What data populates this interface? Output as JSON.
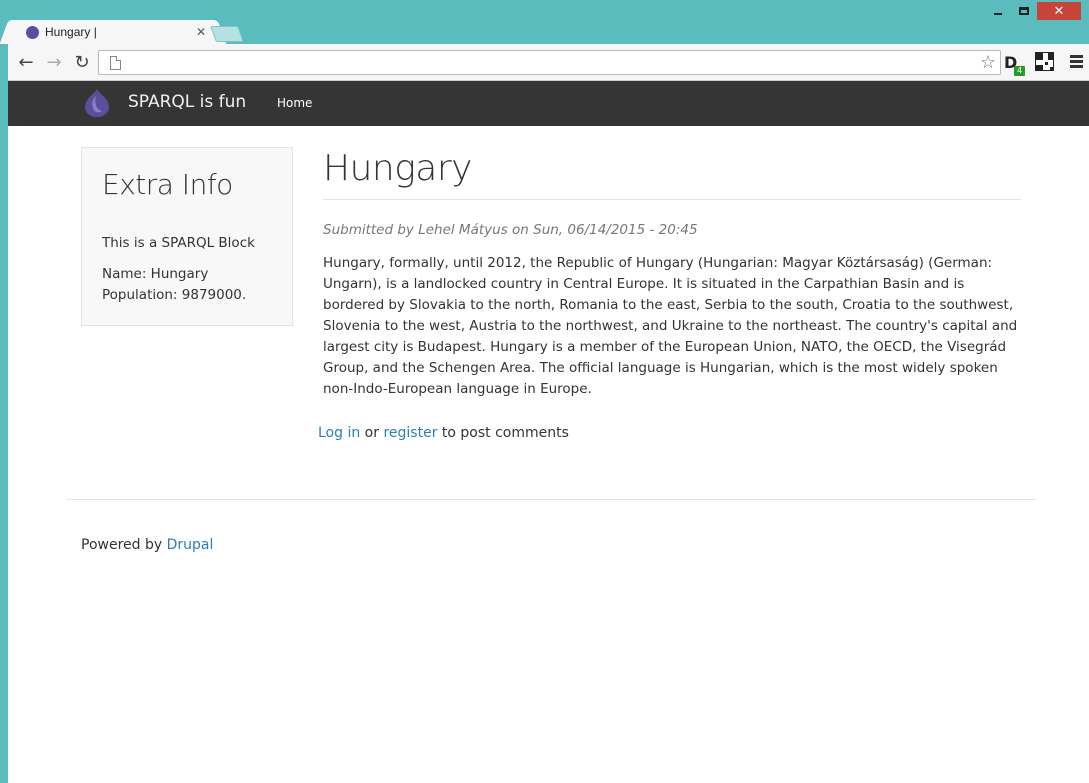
{
  "browser": {
    "tab": {
      "title": "Hungary |",
      "close_glyph": "✕",
      "favicon": "drop-logo-icon"
    },
    "toolbar": {
      "back_glyph": "←",
      "forward_glyph": "→",
      "reload_glyph": "↻",
      "url": "",
      "star_glyph": "☆",
      "extension_d_label": "D",
      "extension_badge": "4"
    },
    "window": {
      "close_glyph": "✕"
    }
  },
  "site": {
    "brand": "SPARQL is fun",
    "nav": [
      {
        "label": "Home"
      }
    ]
  },
  "sidebar": {
    "title": "Extra Info",
    "block_text": "This is a SPARQL Block",
    "name_line": "Name: Hungary",
    "population_line": "Population: 9879000."
  },
  "article": {
    "title": "Hungary",
    "submitted": "Submitted by Lehel Mátyus on Sun, 06/14/2015 - 20:45",
    "body_lines": [
      "Hungary, formally, until 2012, the Republic of Hungary (Hungarian: Magyar Köztársaság) (German:",
      "Ungarn), is a landlocked country in Central Europe. It is situated in the Carpathian Basin and is",
      "bordered by Slovakia to the north, Romania to the east, Serbia to the south, Croatia to the southwest,",
      "Slovenia to the west, Austria to the northwest, and Ukraine to the northeast. The country's capital and",
      "largest city is Budapest. Hungary is a member of the European Union, NATO, the OECD, the Visegrád",
      "Group, and the Schengen Area. The official language is Hungarian, which is the most widely spoken",
      "non-Indo-European language in Europe."
    ],
    "comment_links": {
      "login": "Log in",
      "or": " or ",
      "register": "register",
      "suffix": " to post comments"
    }
  },
  "footer": {
    "prefix": "Powered by ",
    "link": "Drupal"
  },
  "colors": {
    "window_frame": "#5bbcbd",
    "navbar": "#353535",
    "link": "#2a7fb8",
    "logo": "#5b4e9c"
  }
}
